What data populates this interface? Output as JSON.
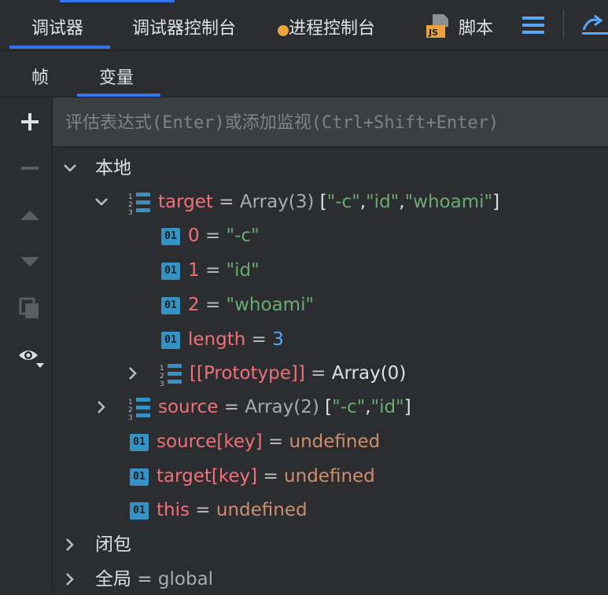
{
  "top_tabs": [
    {
      "label": "调试器"
    },
    {
      "label": "调试器控制台"
    },
    {
      "label": "进程控制台"
    },
    {
      "label": "脚本"
    }
  ],
  "sub_tabs": [
    {
      "label": "帧"
    },
    {
      "label": "变量"
    }
  ],
  "eval": {
    "placeholder": "评估表达式(Enter)或添加监视(Ctrl+Shift+Enter)"
  },
  "tree": {
    "local": "本地",
    "target": {
      "name": "target",
      "type": "Array(3)",
      "preview_open": "[",
      "v0": "\"-c\"",
      "sep1": ",",
      "v1": "\"id\"",
      "sep2": ",",
      "v2": "\"whoami\"",
      "preview_close": "]"
    },
    "items": [
      {
        "name": "0",
        "value": "\"-c\""
      },
      {
        "name": "1",
        "value": "\"id\""
      },
      {
        "name": "2",
        "value": "\"whoami\""
      },
      {
        "name": "length",
        "value": "3"
      }
    ],
    "proto": {
      "name": "[[Prototype]]",
      "value": "Array(0)"
    },
    "source": {
      "name": "source",
      "type": "Array(2)",
      "preview_open": "[",
      "v0": "\"-c\"",
      "sep1": ",",
      "v1": "\"id\"",
      "preview_close": "]"
    },
    "undefs": [
      {
        "name": "source[key]",
        "value": "undefined"
      },
      {
        "name": "target[key]",
        "value": "undefined"
      },
      {
        "name": "this",
        "value": "undefined"
      }
    ],
    "closure": "闭包",
    "global": {
      "name": "全局",
      "value": "global"
    }
  },
  "eq": "=",
  "badge": "01",
  "colors": {
    "accent": "#3574f0",
    "string": "#6aab73",
    "name": "#f07178",
    "undefined": "#cf8e6d",
    "number": "#56a8f5"
  }
}
